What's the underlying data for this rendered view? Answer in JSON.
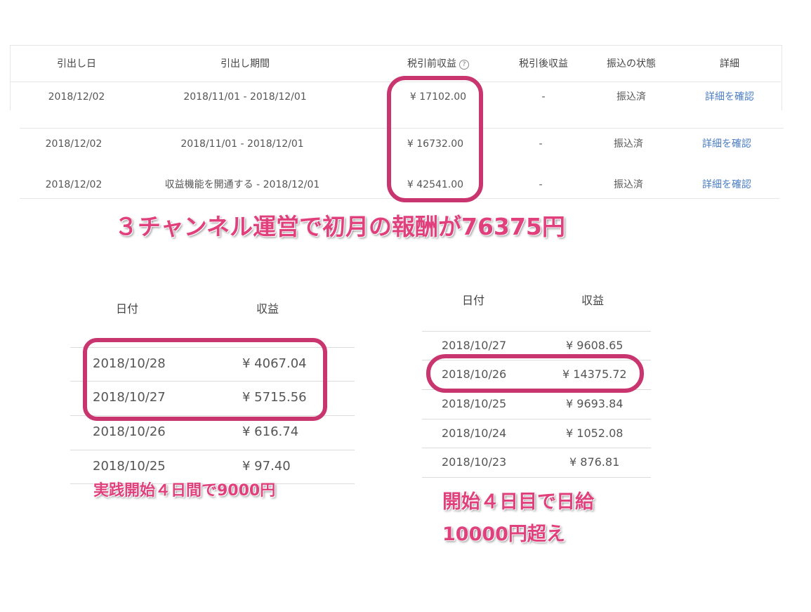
{
  "payouts": {
    "headers": {
      "date": "引出し日",
      "period": "引出し期間",
      "gross": "税引前収益",
      "net": "税引後収益",
      "status": "振込の状態",
      "detail": "詳細"
    },
    "help_icon": "?",
    "rows": [
      {
        "date": "2018/12/02",
        "period": "2018/11/01 - 2018/12/01",
        "gross": "¥ 17102.00",
        "net": "-",
        "status": "振込済",
        "detail": "詳細を確認"
      },
      {
        "date": "2018/12/02",
        "period": "2018/11/01 - 2018/12/01",
        "gross": "¥ 16732.00",
        "net": "-",
        "status": "振込済",
        "detail": "詳細を確認"
      },
      {
        "date": "2018/12/02",
        "period": "収益機能を開通する - 2018/12/01",
        "gross": "¥ 42541.00",
        "net": "-",
        "status": "振込済",
        "detail": "詳細を確認"
      }
    ]
  },
  "captions": {
    "top": "３チャンネル運営で初月の報酬が76375円",
    "left": "実践開始４日間で9000円",
    "right_line1": "開始４日目で日給",
    "right_line2": "10000円超え"
  },
  "daily_left": {
    "headers": {
      "date": "日付",
      "revenue": "収益"
    },
    "rows": [
      {
        "date": "2018/10/28",
        "revenue": "¥ 4067.04"
      },
      {
        "date": "2018/10/27",
        "revenue": "¥ 5715.56"
      },
      {
        "date": "2018/10/26",
        "revenue": "¥ 616.74"
      },
      {
        "date": "2018/10/25",
        "revenue": "¥ 97.40"
      }
    ]
  },
  "daily_right": {
    "headers": {
      "date": "日付",
      "revenue": "収益"
    },
    "rows": [
      {
        "date": "2018/10/27",
        "revenue": "¥ 9608.65"
      },
      {
        "date": "2018/10/26",
        "revenue": "¥ 14375.72"
      },
      {
        "date": "2018/10/25",
        "revenue": "¥ 9693.84"
      },
      {
        "date": "2018/10/24",
        "revenue": "¥ 1052.08"
      },
      {
        "date": "2018/10/23",
        "revenue": "¥ 876.81"
      }
    ]
  },
  "colors": {
    "highlight": "#c8356f",
    "caption": "#e0407c",
    "link": "#4a7dc4"
  }
}
